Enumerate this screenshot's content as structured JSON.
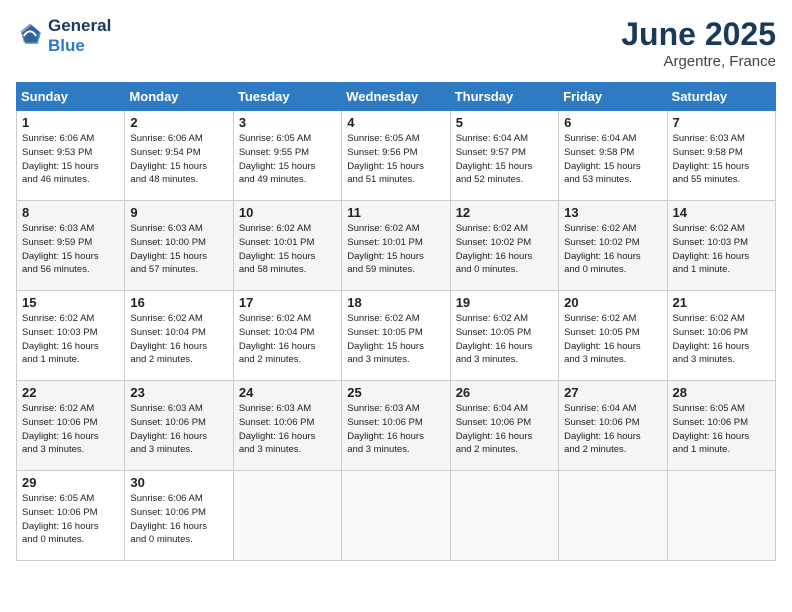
{
  "header": {
    "logo_line1": "General",
    "logo_line2": "Blue",
    "title": "June 2025",
    "subtitle": "Argentre, France"
  },
  "calendar": {
    "weekdays": [
      "Sunday",
      "Monday",
      "Tuesday",
      "Wednesday",
      "Thursday",
      "Friday",
      "Saturday"
    ],
    "weeks": [
      [
        {
          "day": "1",
          "detail": "Sunrise: 6:06 AM\nSunset: 9:53 PM\nDaylight: 15 hours\nand 46 minutes."
        },
        {
          "day": "2",
          "detail": "Sunrise: 6:06 AM\nSunset: 9:54 PM\nDaylight: 15 hours\nand 48 minutes."
        },
        {
          "day": "3",
          "detail": "Sunrise: 6:05 AM\nSunset: 9:55 PM\nDaylight: 15 hours\nand 49 minutes."
        },
        {
          "day": "4",
          "detail": "Sunrise: 6:05 AM\nSunset: 9:56 PM\nDaylight: 15 hours\nand 51 minutes."
        },
        {
          "day": "5",
          "detail": "Sunrise: 6:04 AM\nSunset: 9:57 PM\nDaylight: 15 hours\nand 52 minutes."
        },
        {
          "day": "6",
          "detail": "Sunrise: 6:04 AM\nSunset: 9:58 PM\nDaylight: 15 hours\nand 53 minutes."
        },
        {
          "day": "7",
          "detail": "Sunrise: 6:03 AM\nSunset: 9:58 PM\nDaylight: 15 hours\nand 55 minutes."
        }
      ],
      [
        {
          "day": "8",
          "detail": "Sunrise: 6:03 AM\nSunset: 9:59 PM\nDaylight: 15 hours\nand 56 minutes."
        },
        {
          "day": "9",
          "detail": "Sunrise: 6:03 AM\nSunset: 10:00 PM\nDaylight: 15 hours\nand 57 minutes."
        },
        {
          "day": "10",
          "detail": "Sunrise: 6:02 AM\nSunset: 10:01 PM\nDaylight: 15 hours\nand 58 minutes."
        },
        {
          "day": "11",
          "detail": "Sunrise: 6:02 AM\nSunset: 10:01 PM\nDaylight: 15 hours\nand 59 minutes."
        },
        {
          "day": "12",
          "detail": "Sunrise: 6:02 AM\nSunset: 10:02 PM\nDaylight: 16 hours\nand 0 minutes."
        },
        {
          "day": "13",
          "detail": "Sunrise: 6:02 AM\nSunset: 10:02 PM\nDaylight: 16 hours\nand 0 minutes."
        },
        {
          "day": "14",
          "detail": "Sunrise: 6:02 AM\nSunset: 10:03 PM\nDaylight: 16 hours\nand 1 minute."
        }
      ],
      [
        {
          "day": "15",
          "detail": "Sunrise: 6:02 AM\nSunset: 10:03 PM\nDaylight: 16 hours\nand 1 minute."
        },
        {
          "day": "16",
          "detail": "Sunrise: 6:02 AM\nSunset: 10:04 PM\nDaylight: 16 hours\nand 2 minutes."
        },
        {
          "day": "17",
          "detail": "Sunrise: 6:02 AM\nSunset: 10:04 PM\nDaylight: 16 hours\nand 2 minutes."
        },
        {
          "day": "18",
          "detail": "Sunrise: 6:02 AM\nSunset: 10:05 PM\nDaylight: 15 hours\nand 3 minutes."
        },
        {
          "day": "19",
          "detail": "Sunrise: 6:02 AM\nSunset: 10:05 PM\nDaylight: 16 hours\nand 3 minutes."
        },
        {
          "day": "20",
          "detail": "Sunrise: 6:02 AM\nSunset: 10:05 PM\nDaylight: 16 hours\nand 3 minutes."
        },
        {
          "day": "21",
          "detail": "Sunrise: 6:02 AM\nSunset: 10:06 PM\nDaylight: 16 hours\nand 3 minutes."
        }
      ],
      [
        {
          "day": "22",
          "detail": "Sunrise: 6:02 AM\nSunset: 10:06 PM\nDaylight: 16 hours\nand 3 minutes."
        },
        {
          "day": "23",
          "detail": "Sunrise: 6:03 AM\nSunset: 10:06 PM\nDaylight: 16 hours\nand 3 minutes."
        },
        {
          "day": "24",
          "detail": "Sunrise: 6:03 AM\nSunset: 10:06 PM\nDaylight: 16 hours\nand 3 minutes."
        },
        {
          "day": "25",
          "detail": "Sunrise: 6:03 AM\nSunset: 10:06 PM\nDaylight: 16 hours\nand 3 minutes."
        },
        {
          "day": "26",
          "detail": "Sunrise: 6:04 AM\nSunset: 10:06 PM\nDaylight: 16 hours\nand 2 minutes."
        },
        {
          "day": "27",
          "detail": "Sunrise: 6:04 AM\nSunset: 10:06 PM\nDaylight: 16 hours\nand 2 minutes."
        },
        {
          "day": "28",
          "detail": "Sunrise: 6:05 AM\nSunset: 10:06 PM\nDaylight: 16 hours\nand 1 minute."
        }
      ],
      [
        {
          "day": "29",
          "detail": "Sunrise: 6:05 AM\nSunset: 10:06 PM\nDaylight: 16 hours\nand 0 minutes."
        },
        {
          "day": "30",
          "detail": "Sunrise: 6:06 AM\nSunset: 10:06 PM\nDaylight: 16 hours\nand 0 minutes."
        },
        {
          "day": "",
          "detail": ""
        },
        {
          "day": "",
          "detail": ""
        },
        {
          "day": "",
          "detail": ""
        },
        {
          "day": "",
          "detail": ""
        },
        {
          "day": "",
          "detail": ""
        }
      ]
    ]
  }
}
